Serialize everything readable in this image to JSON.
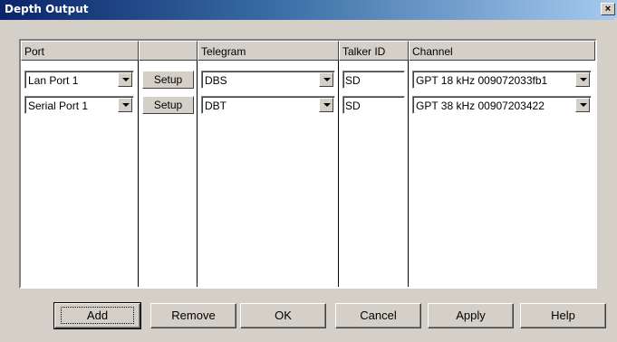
{
  "window": {
    "title": "Depth Output",
    "close_glyph": "×"
  },
  "table": {
    "columns": [
      "Port",
      "",
      "Telegram",
      "Talker ID",
      "Channel"
    ],
    "rows": [
      {
        "port": "Lan Port 1",
        "setup_label": "Setup",
        "telegram": "DBS",
        "talker_id": "SD",
        "channel": "GPT  18 kHz 009072033fb1"
      },
      {
        "port": "Serial Port 1",
        "setup_label": "Setup",
        "telegram": "DBT",
        "talker_id": "SD",
        "channel": "GPT  38 kHz 00907203422"
      }
    ]
  },
  "buttons": {
    "add": "Add",
    "remove": "Remove",
    "ok": "OK",
    "cancel": "Cancel",
    "apply": "Apply",
    "help": "Help"
  },
  "colors": {
    "titlebar_start": "#0a246a",
    "titlebar_end": "#a6caf0",
    "face": "#d4d0c8"
  }
}
